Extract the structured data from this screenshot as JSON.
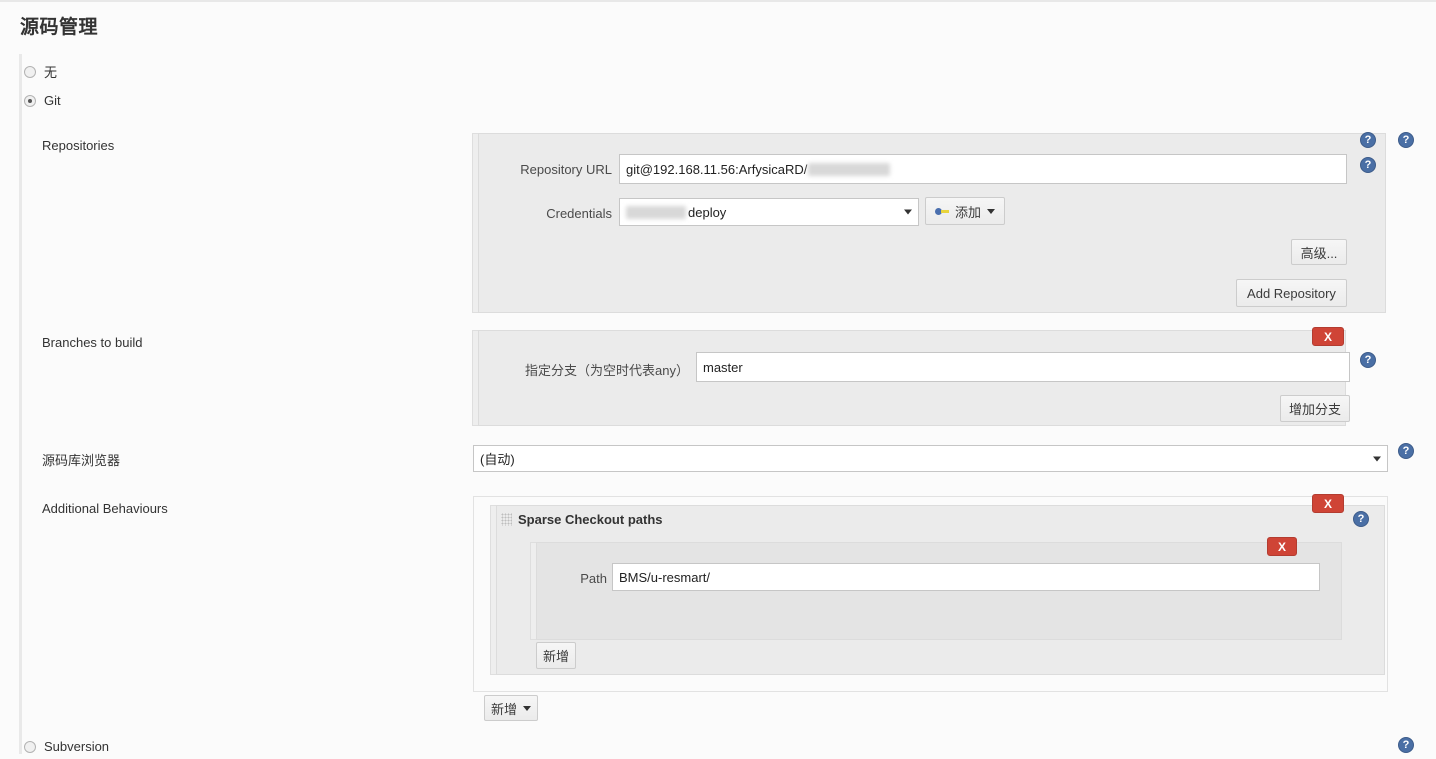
{
  "page": {
    "title": "源码管理"
  },
  "scm_options": [
    {
      "label": "无",
      "selected": false
    },
    {
      "label": "Git",
      "selected": true
    },
    {
      "label": "Subversion",
      "selected": false
    }
  ],
  "repositories": {
    "section_label": "Repositories",
    "repository_url": {
      "label": "Repository URL",
      "value": "git@192.168.11.56:ArfysicaRD/",
      "redacted": true
    },
    "credentials": {
      "label": "Credentials",
      "value": "deploy",
      "redacted_prefix": true,
      "add_button": "添加"
    },
    "advanced_button": "高级...",
    "add_repository_button": "Add Repository"
  },
  "branches": {
    "section_label": "Branches to build",
    "branch_specifier": {
      "label": "指定分支（为空时代表any）",
      "value": "master"
    },
    "add_branch_button": "增加分支",
    "delete_button": "X"
  },
  "repo_browser": {
    "label": "源码库浏览器",
    "value": "(自动)"
  },
  "additional_behaviours": {
    "section_label": "Additional Behaviours",
    "behaviour": {
      "title": "Sparse Checkout paths",
      "delete_button": "X",
      "path_entry": {
        "label": "Path",
        "value": "BMS/u-resmart/",
        "delete_button": "X"
      },
      "add_path_button": "新增"
    },
    "add_behaviour_button": "新增"
  },
  "icons": {
    "help": "?",
    "key": "key-icon"
  }
}
